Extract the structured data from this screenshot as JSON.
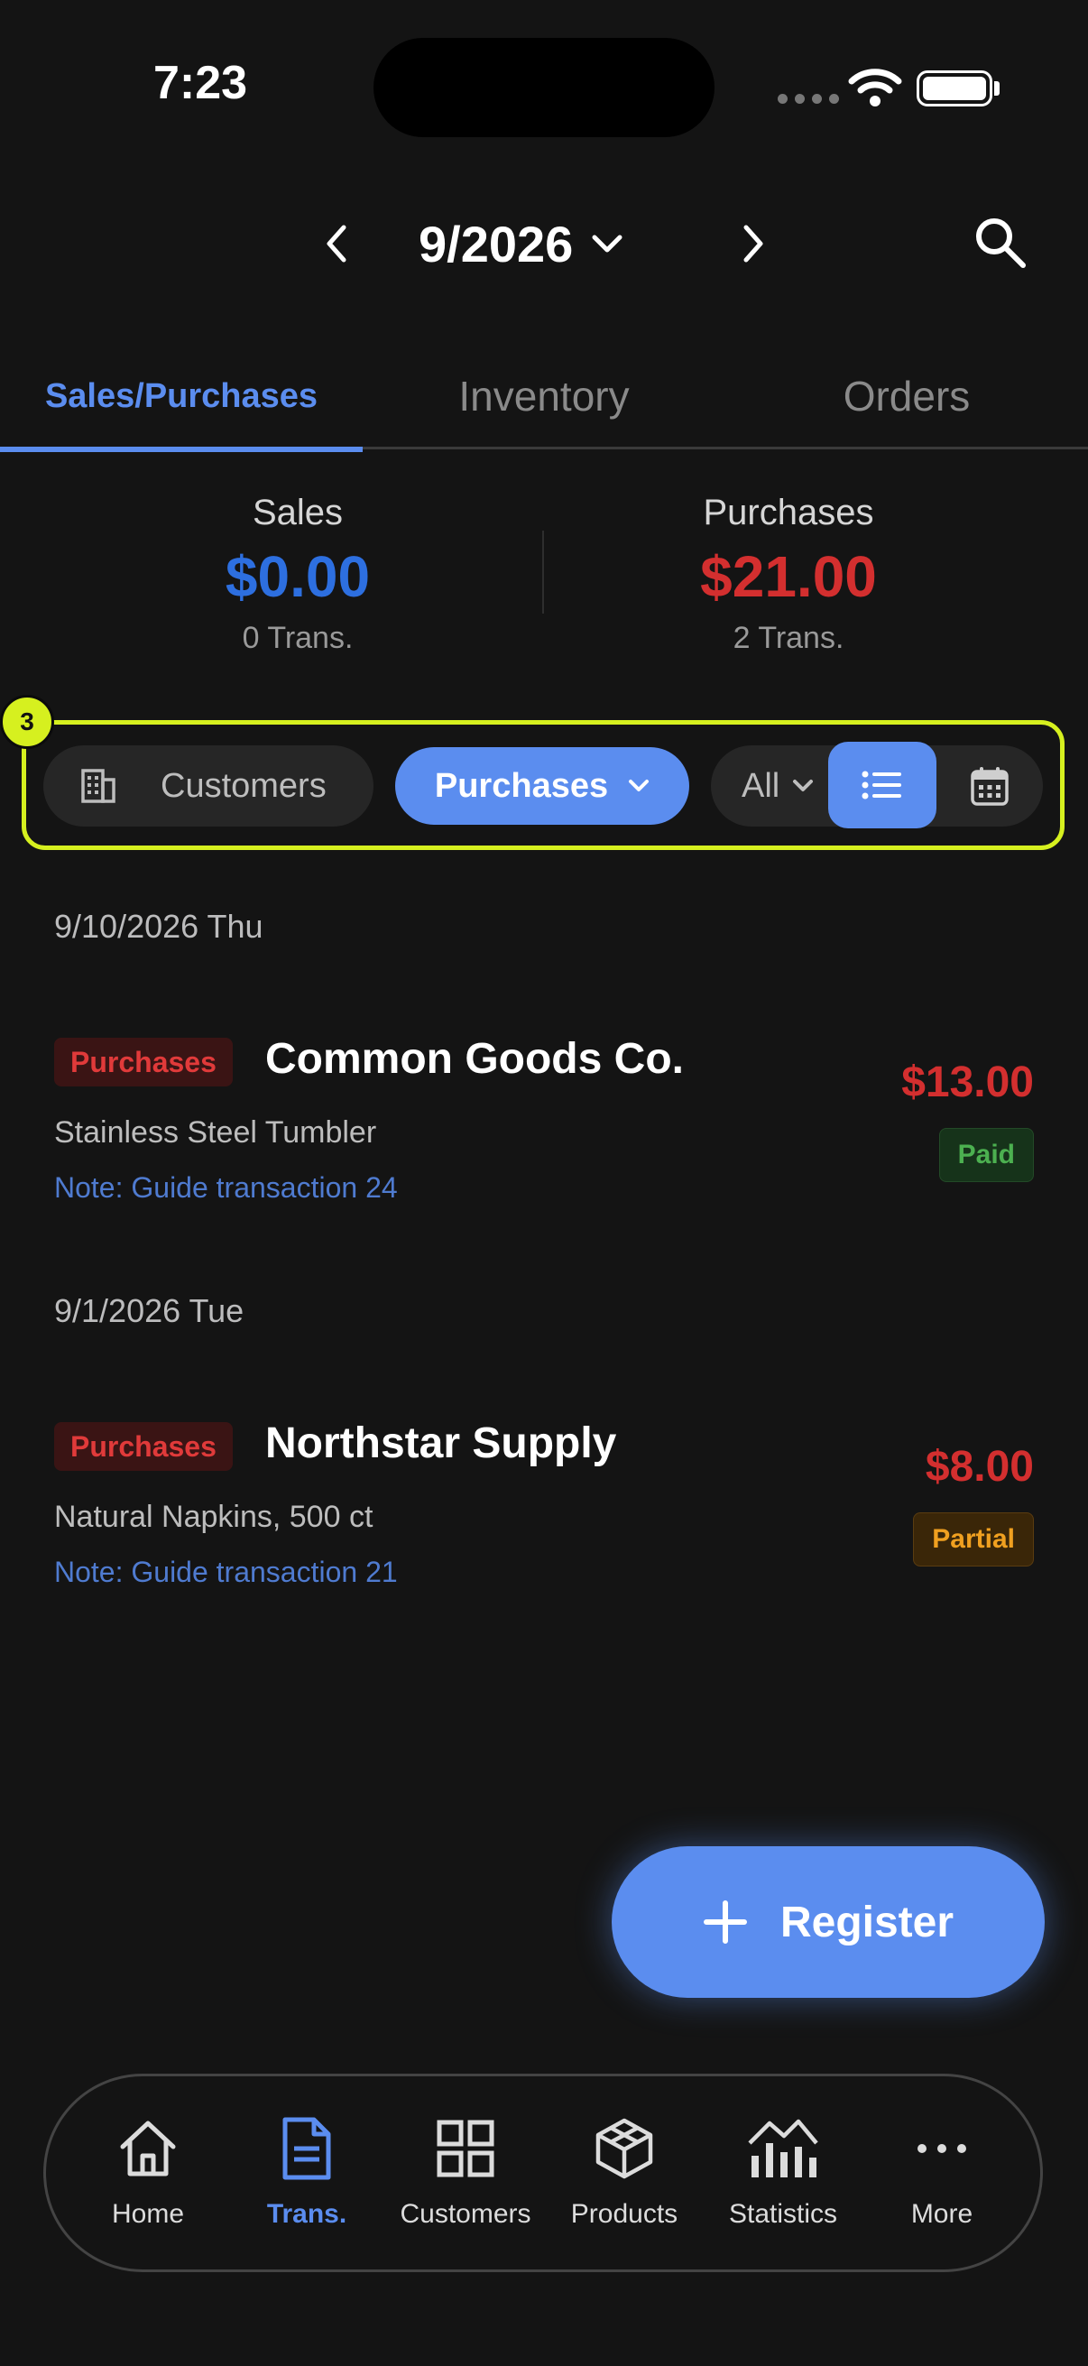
{
  "status_bar": {
    "time": "7:23"
  },
  "header": {
    "month": "9/2026"
  },
  "tabs": [
    {
      "label": "Sales/Purchases",
      "active": true
    },
    {
      "label": "Inventory",
      "active": false
    },
    {
      "label": "Orders",
      "active": false
    }
  ],
  "summary": {
    "sales": {
      "label": "Sales",
      "amount": "$0.00",
      "count": "0 Trans."
    },
    "purchases": {
      "label": "Purchases",
      "amount": "$21.00",
      "count": "2 Trans."
    }
  },
  "filters": {
    "badge": "3",
    "customers_label": "Customers",
    "type_label": "Purchases",
    "status_label": "All"
  },
  "groups": [
    {
      "date": "9/10/2026 Thu",
      "items": [
        {
          "tag": "Purchases",
          "vendor": "Common Goods Co.",
          "product": "Stainless Steel Tumbler",
          "note": "Note: Guide transaction 24",
          "amount": "$13.00",
          "status": "Paid"
        }
      ]
    },
    {
      "date": "9/1/2026 Tue",
      "items": [
        {
          "tag": "Purchases",
          "vendor": "Northstar Supply",
          "product": "Natural Napkins, 500 ct",
          "note": "Note: Guide transaction 21",
          "amount": "$8.00",
          "status": "Partial"
        }
      ]
    }
  ],
  "fab": {
    "label": "Register"
  },
  "bottom_nav": [
    {
      "label": "Home",
      "icon": "home-icon"
    },
    {
      "label": "Trans.",
      "icon": "document-icon",
      "active": true
    },
    {
      "label": "Customers",
      "icon": "grid-icon"
    },
    {
      "label": "Products",
      "icon": "cube-icon"
    },
    {
      "label": "Statistics",
      "icon": "chart-icon"
    },
    {
      "label": "More",
      "icon": "more-icon"
    }
  ],
  "colors": {
    "accent": "#5b8def",
    "sales": "#2d6fe0",
    "purchases": "#d32f2f",
    "highlight": "#d6f01f"
  }
}
